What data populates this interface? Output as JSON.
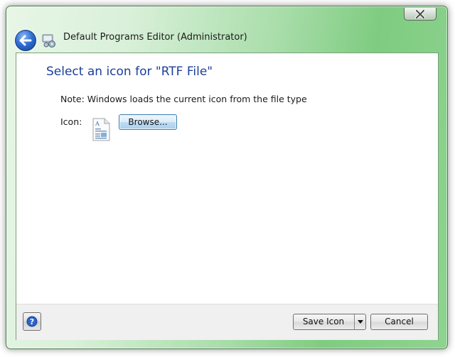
{
  "window": {
    "title": "Default Programs Editor (Administrator)",
    "close_icon": "close-icon",
    "back_icon": "back-arrow-icon",
    "app_icon": "default-programs-icon"
  },
  "page": {
    "heading": "Select an icon for \"RTF File\"",
    "note": "Note: Windows loads the current icon from the file type",
    "icon_label": "Icon:",
    "current_icon": "rtf-document-icon",
    "browse_label": "Browse..."
  },
  "footer": {
    "help_icon": "help-icon",
    "save_label": "Save Icon",
    "save_dropdown_icon": "chevron-down-icon",
    "cancel_label": "Cancel"
  },
  "colors": {
    "heading": "#1d3f9a",
    "frame_green": "#7fcc81",
    "browse_blue": "#bfdcf2"
  }
}
